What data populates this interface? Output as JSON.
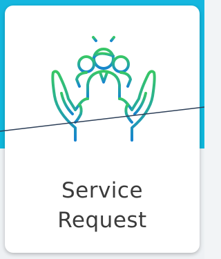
{
  "tile": {
    "title_line1": "Service",
    "title_line2": "Request",
    "icon": "service-hands-team-icon"
  },
  "colors": {
    "background_top": "#15b7df",
    "card": "#ffffff",
    "icon_green": "#35c46a",
    "icon_blue": "#1a86c8",
    "text": "#3b3b3b"
  }
}
